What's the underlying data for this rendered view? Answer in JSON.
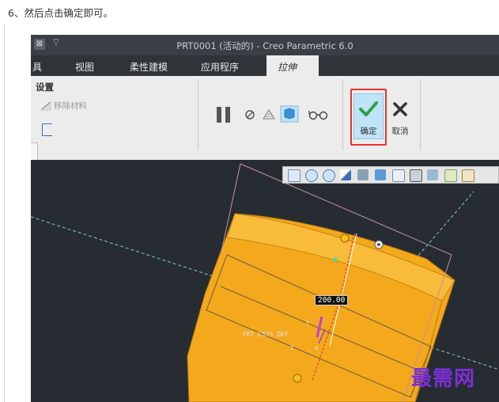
{
  "instruction": "6、然后点击确定即可。",
  "window": {
    "title": "PRT0001 (活动的) - Creo Parametric 6.0",
    "menu_icon": "⊠",
    "dropdown_arrow": "▽"
  },
  "tabs": [
    {
      "label": "具"
    },
    {
      "label": "视图"
    },
    {
      "label": "柔性建模"
    },
    {
      "label": "应用程序"
    },
    {
      "label": "拉伸",
      "active": true
    }
  ],
  "ribbon": {
    "settings_title": "设置",
    "remove_material": "移除材料",
    "ok_label": "确定",
    "cancel_label": "取消"
  },
  "viewport": {
    "dimension": "200.00",
    "csys_label": "PRT_CSYS_DEF",
    "axis_y": "Y",
    "axis_z": "Z",
    "axis_x": "X"
  },
  "watermark": "最需网",
  "colors": {
    "part_fill": "#f4a81c",
    "ok_highlight": "#e53333",
    "check_green": "#2ea043",
    "viewport_bg": "#272c32"
  }
}
